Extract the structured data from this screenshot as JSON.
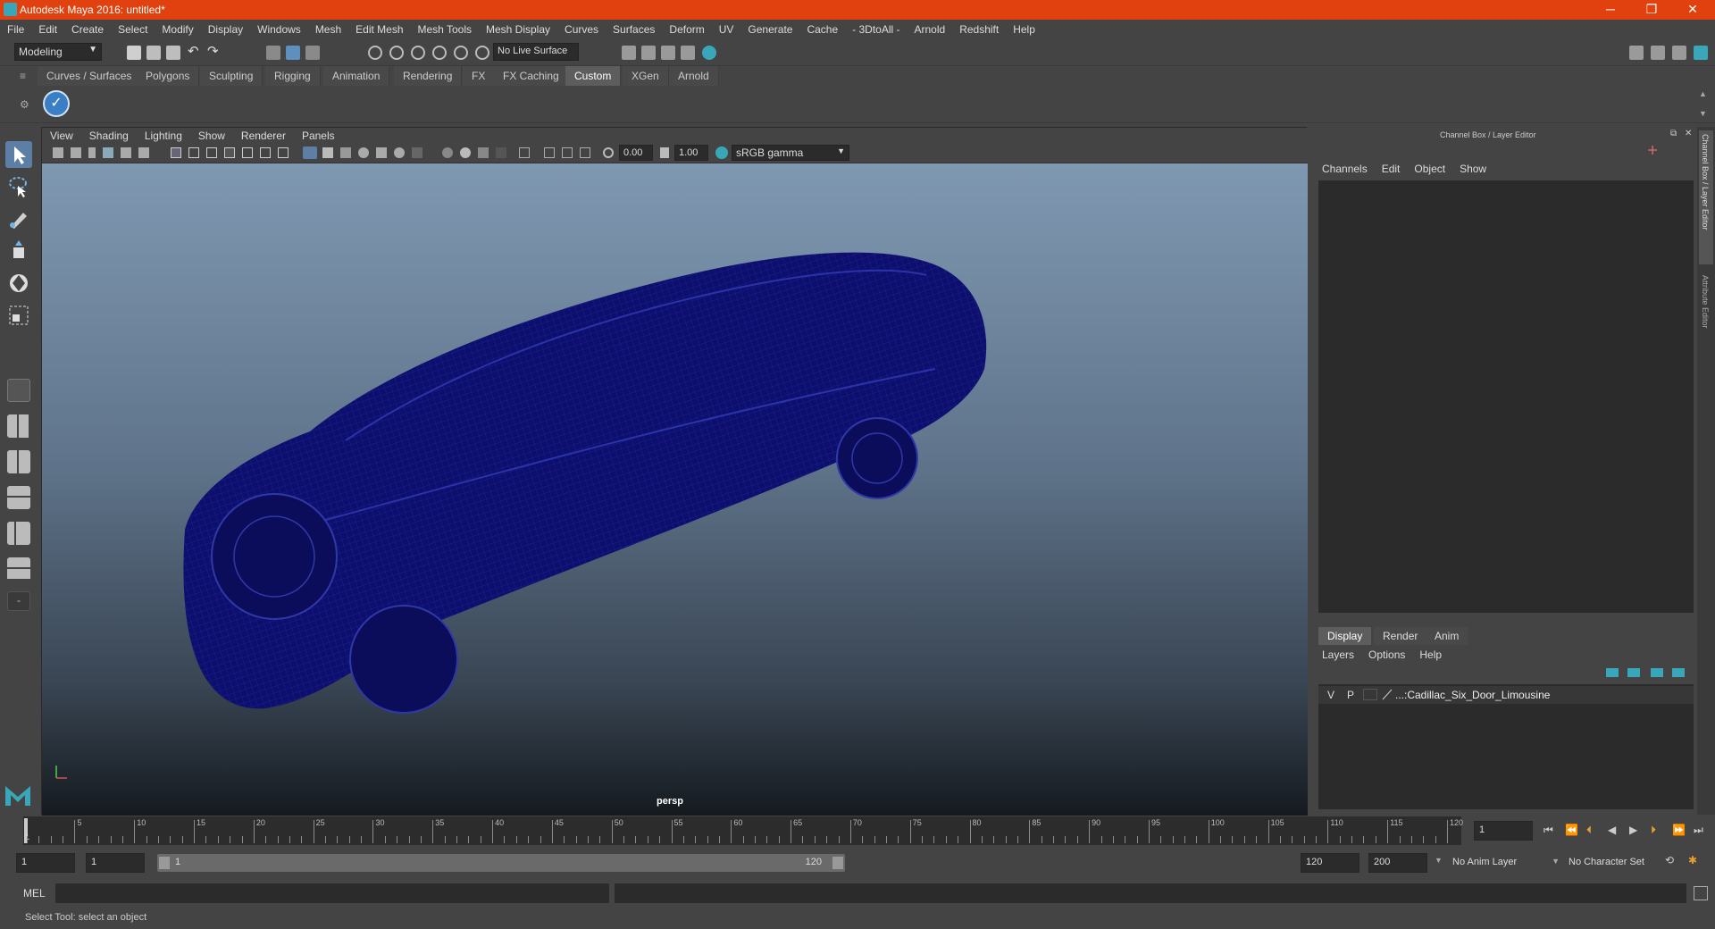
{
  "window": {
    "title": "Autodesk Maya 2016: untitled*",
    "min": "─",
    "max": "❐",
    "close": "✕"
  },
  "menu": [
    "File",
    "Edit",
    "Create",
    "Select",
    "Modify",
    "Display",
    "Windows",
    "Mesh",
    "Edit Mesh",
    "Mesh Tools",
    "Mesh Display",
    "Curves",
    "Surfaces",
    "Deform",
    "UV",
    "Generate",
    "Cache",
    "- 3DtoAll -",
    "Arnold",
    "Redshift",
    "Help"
  ],
  "status": {
    "mode": "Modeling",
    "live_surface": "No Live Surface"
  },
  "shelf_tabs": [
    "Curves / Surfaces",
    "Polygons",
    "Sculpting",
    "Rigging",
    "Animation",
    "Rendering",
    "FX",
    "FX Caching",
    "Custom",
    "XGen",
    "Arnold"
  ],
  "shelf_active": "Custom",
  "viewport": {
    "menu": [
      "View",
      "Shading",
      "Lighting",
      "Show",
      "Renderer",
      "Panels"
    ],
    "exposure": "0.00",
    "gamma": "1.00",
    "colorspace": "sRGB gamma",
    "camera": "persp"
  },
  "channel_box": {
    "title": "Channel Box / Layer Editor",
    "menu": [
      "Channels",
      "Edit",
      "Object",
      "Show"
    ],
    "tabs": [
      "Display",
      "Render",
      "Anim"
    ],
    "layer_menu": [
      "Layers",
      "Options",
      "Help"
    ],
    "layer": {
      "v": "V",
      "p": "P",
      "name": "...:Cadillac_Six_Door_Limousine"
    }
  },
  "side_tabs": {
    "channel": "Channel Box / Layer Editor",
    "attr": "Attribute Editor"
  },
  "timeline": {
    "ticks": [
      "5",
      "10",
      "15",
      "20",
      "25",
      "30",
      "35",
      "40",
      "45",
      "50",
      "55",
      "60",
      "65",
      "70",
      "75",
      "80",
      "85",
      "90",
      "95",
      "100",
      "105",
      "110",
      "115",
      "120"
    ],
    "first": "1",
    "current_frame": "1"
  },
  "range": {
    "start": "1",
    "playback_start": "1",
    "slider_start": "1",
    "slider_end": "120",
    "playback_end": "120",
    "end": "200",
    "anim_layer": "No Anim Layer",
    "char_set": "No Character Set"
  },
  "cmd": {
    "label": "MEL"
  },
  "help": {
    "text": "Select Tool: select an object"
  },
  "colors": {
    "titlebar": "#e0410f",
    "wire": "#0d0f6e",
    "accent": "#3aa6b9"
  }
}
